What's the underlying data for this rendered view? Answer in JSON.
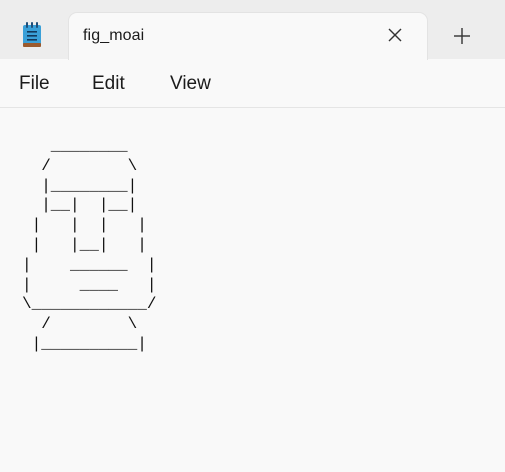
{
  "window": {
    "app_icon": "notepad-icon"
  },
  "tab": {
    "title": "fig_moai",
    "close_icon": "close-icon"
  },
  "new_tab": {
    "icon": "plus-icon"
  },
  "menu": {
    "items": [
      {
        "label": "File"
      },
      {
        "label": "Edit"
      },
      {
        "label": "View"
      }
    ]
  },
  "editor": {
    "text": "   ________\n  /        \\\n  |________|\n  |__|  |__|\n |   |  |   |\n |   |__|   |\n|    ______  |\n|     ____   |\n\\____________/\n  /        \\\n |__________|"
  }
}
